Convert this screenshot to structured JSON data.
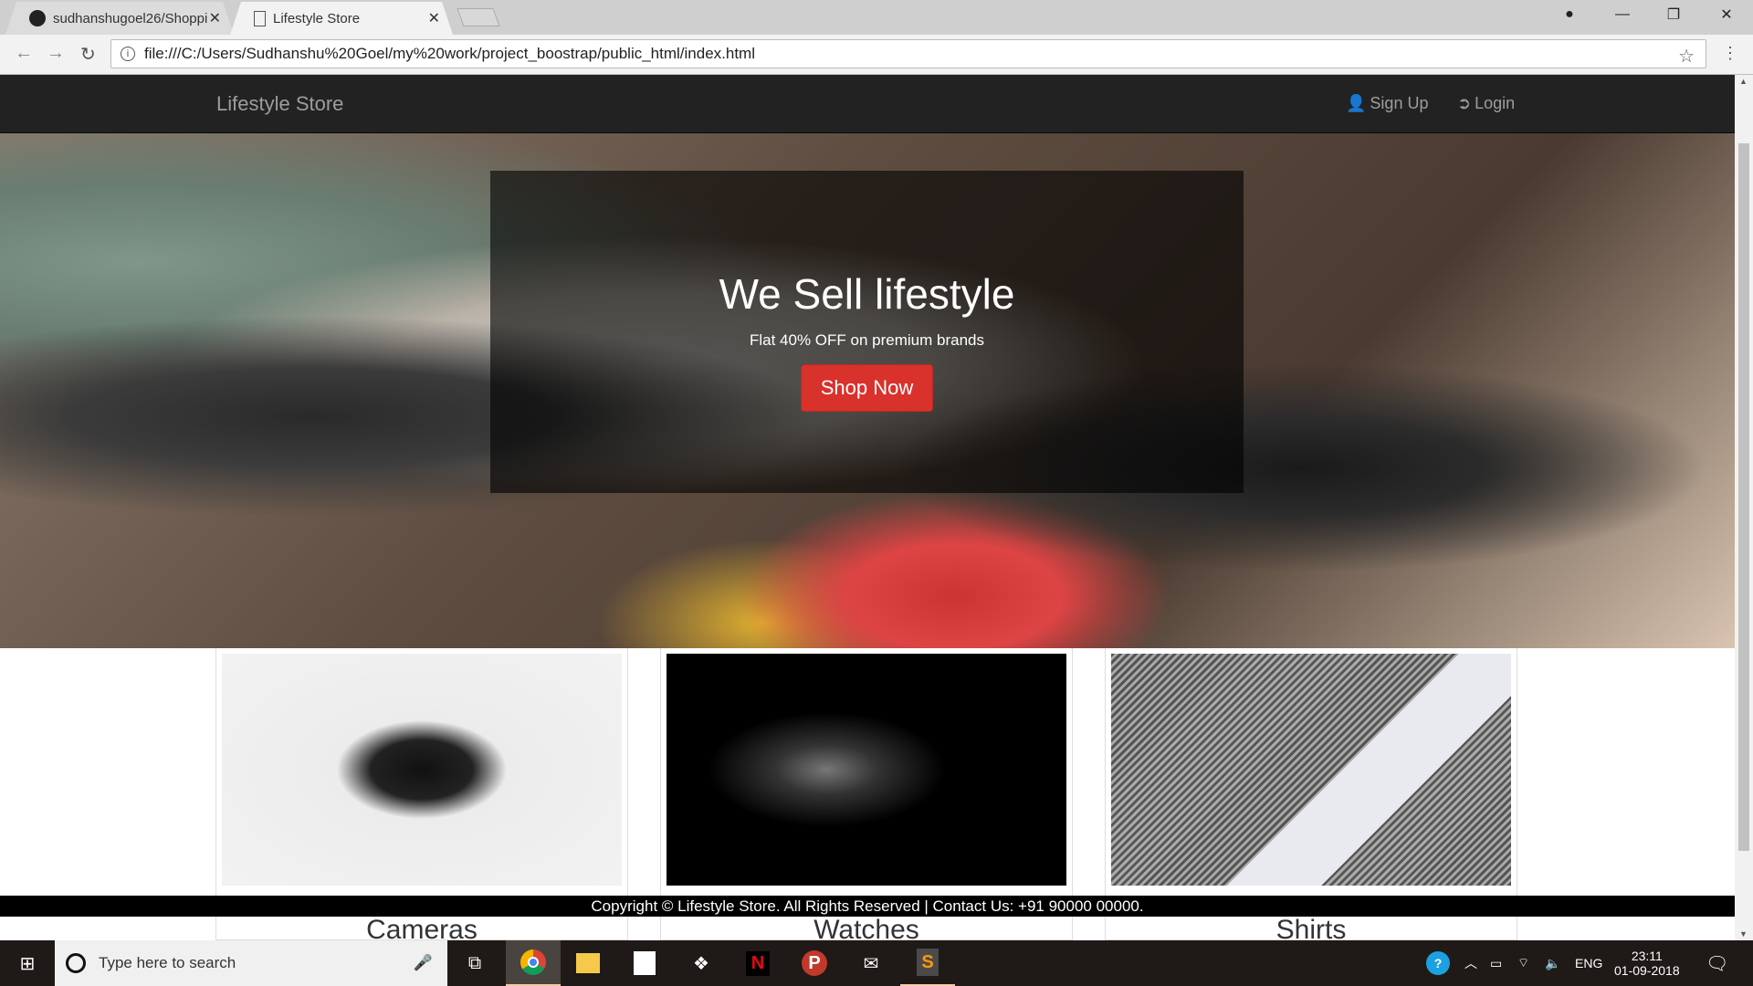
{
  "browser": {
    "tabs": [
      {
        "label": "sudhanshugoel26/Shoppi",
        "icon": "github-icon"
      },
      {
        "label": "Lifestyle Store",
        "icon": "page-icon",
        "active": true
      }
    ],
    "url": "file:///C:/Users/Sudhanshu%20Goel/my%20work/project_boostrap/public_html/index.html"
  },
  "navbar": {
    "brand": "Lifestyle Store",
    "links": [
      {
        "label": "Sign Up",
        "icon": "user-icon"
      },
      {
        "label": "Login",
        "icon": "login-icon"
      }
    ]
  },
  "hero": {
    "title": "We Sell lifestyle",
    "subtitle": "Flat 40% OFF on premium brands",
    "button": "Shop Now"
  },
  "products": [
    {
      "label": "Cameras"
    },
    {
      "label": "Watches"
    },
    {
      "label": "Shirts"
    }
  ],
  "footer": {
    "text": "Copyright © Lifestyle Store. All Rights Reserved | Contact Us: +91 90000 00000."
  },
  "taskbar": {
    "search_placeholder": "Type here to search",
    "language": "ENG",
    "time": "23:11",
    "date": "01-09-2018"
  },
  "colors": {
    "navbar": "#222222",
    "accent": "#d9312b"
  }
}
